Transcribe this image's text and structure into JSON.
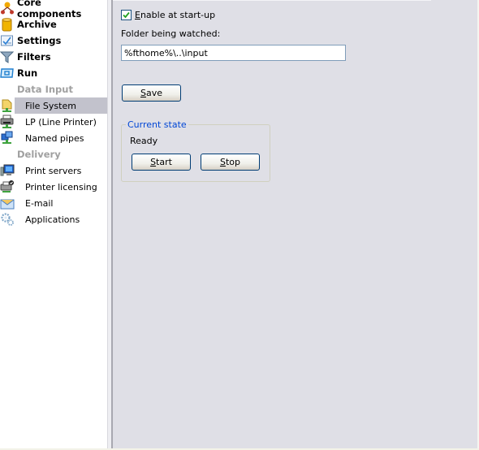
{
  "sidebar": {
    "top_items": [
      {
        "label": "Core components",
        "icon": "core-components-icon"
      },
      {
        "label": "Archive",
        "icon": "archive-icon"
      },
      {
        "label": "Settings",
        "icon": "settings-icon"
      },
      {
        "label": "Filters",
        "icon": "filter-icon"
      },
      {
        "label": "Run",
        "icon": "run-icon"
      }
    ],
    "groups": [
      {
        "label": "Data Input",
        "items": [
          {
            "label": "File System",
            "icon": "file-system-icon",
            "selected": true
          },
          {
            "label": "LP (Line Printer)",
            "icon": "printer-icon",
            "selected": false
          },
          {
            "label": "Named pipes",
            "icon": "named-pipes-icon",
            "selected": false
          }
        ]
      },
      {
        "label": "Delivery",
        "items": [
          {
            "label": "Print servers",
            "icon": "print-server-icon",
            "selected": false
          },
          {
            "label": "Printer licensing",
            "icon": "printer-licensing-icon",
            "selected": false
          },
          {
            "label": "E-mail",
            "icon": "email-icon",
            "selected": false
          },
          {
            "label": "Applications",
            "icon": "applications-gear-icon",
            "selected": false
          }
        ]
      }
    ]
  },
  "main": {
    "enable_checkbox": {
      "label_first": "E",
      "label_rest": "nable at start-up",
      "checked": true
    },
    "folder_label": "Folder being watched:",
    "folder_value": "%fthome%\\..\\input",
    "save_button": {
      "mnemonic": "S",
      "rest": "ave"
    },
    "current_state": {
      "title": "Current state",
      "status": "Ready",
      "start_button": {
        "mnemonic": "S",
        "rest": "tart"
      },
      "stop_button": {
        "mnemonic": "S",
        "rest": "top"
      }
    }
  },
  "colors": {
    "panel_bg": "#dfdfe6",
    "selected_bg": "#c2c2cc",
    "group_title": "#0046d5",
    "button_border": "#003c74"
  }
}
